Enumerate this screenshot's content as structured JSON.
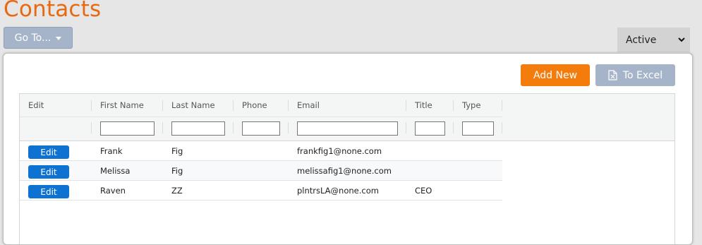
{
  "page": {
    "title": "Contacts"
  },
  "toolbar": {
    "goto_label": "Go To...",
    "status_value": "Active",
    "add_new_label": "Add New",
    "to_excel_label": "To Excel"
  },
  "colors": {
    "title": "#e8690f",
    "add_new": "#f47c0d",
    "secondary_button": "#a5b4c8",
    "edit_button": "#0e72d2"
  },
  "icons": {
    "goto_caret": "caret-down-icon",
    "status_chevron": "chevron-down-icon",
    "excel": "excel-file-icon"
  },
  "grid": {
    "columns": [
      "Edit",
      "First Name",
      "Last Name",
      "Phone",
      "Email",
      "Title",
      "Type"
    ],
    "filters": {
      "first_name": "",
      "last_name": "",
      "phone": "",
      "email": "",
      "title": "",
      "type": ""
    },
    "rows": [
      {
        "edit": "Edit",
        "first_name": "Frank",
        "last_name": "Fig",
        "phone": "",
        "email": "frankfig1@none.com",
        "title": "",
        "type": ""
      },
      {
        "edit": "Edit",
        "first_name": "Melissa",
        "last_name": "Fig",
        "phone": "",
        "email": "melissafig1@none.com",
        "title": "",
        "type": ""
      },
      {
        "edit": "Edit",
        "first_name": "Raven",
        "last_name": "ZZ",
        "phone": "",
        "email": "plntrsLA@none.com",
        "title": "CEO",
        "type": ""
      }
    ]
  }
}
